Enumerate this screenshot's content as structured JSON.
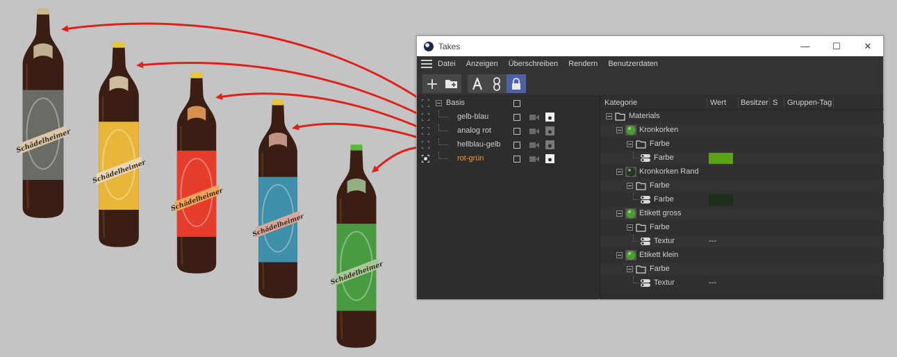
{
  "window": {
    "title": "Takes",
    "min_glyph": "—",
    "max_glyph": "☐",
    "close_glyph": "✕"
  },
  "menu": [
    "Datei",
    "Anzeigen",
    "Überschreiben",
    "Rendern",
    "Benutzerdaten"
  ],
  "takes": [
    {
      "label": "Basis",
      "level": 0,
      "active": false
    },
    {
      "label": "gelb-blau",
      "level": 1,
      "active": false
    },
    {
      "label": "analog rot",
      "level": 1,
      "active": false
    },
    {
      "label": "hellblau-gelb",
      "level": 1,
      "active": false
    },
    {
      "label": "rot-grün",
      "level": 1,
      "active": true
    }
  ],
  "columns": {
    "kategorie": "Kategorie",
    "wert": "Wert",
    "besitzer": "Besitzer",
    "s": "S",
    "gruppen_tag": "Gruppen-Tag"
  },
  "categories": [
    {
      "label": "Materials",
      "type": "folder",
      "level": 0
    },
    {
      "label": "Kronkorken",
      "type": "material",
      "level": 1,
      "ball_color": "#4aa02a"
    },
    {
      "label": "Farbe",
      "type": "folder",
      "level": 2
    },
    {
      "label": "Farbe",
      "type": "param",
      "level": 3,
      "swatch": "#5aa317"
    },
    {
      "label": "Kronkorken Rand",
      "type": "material",
      "level": 1,
      "ball_color": "#1f3a1a"
    },
    {
      "label": "Farbe",
      "type": "folder",
      "level": 2
    },
    {
      "label": "Farbe",
      "type": "param",
      "level": 3,
      "swatch": "#1e2e18"
    },
    {
      "label": "Etikett gross",
      "type": "material",
      "level": 1,
      "ball_color": "#4aa02a"
    },
    {
      "label": "Farbe",
      "type": "folder",
      "level": 2
    },
    {
      "label": "Textur",
      "type": "param",
      "level": 3,
      "value": "---"
    },
    {
      "label": "Etikett klein",
      "type": "material",
      "level": 1,
      "ball_color": "#4aa02a"
    },
    {
      "label": "Farbe",
      "type": "folder",
      "level": 2
    },
    {
      "label": "Textur",
      "type": "param",
      "level": 3,
      "value": "---"
    }
  ],
  "bottles": [
    {
      "brand": "Schädelheimer",
      "label_color": "#6b6b66",
      "cap_color": "#c9b98c",
      "ribbon_color": "#d9c9a8"
    },
    {
      "brand": "Schädelheimer",
      "label_color": "#e8b73a",
      "cap_color": "#e5c640",
      "ribbon_color": "#e9d7b6"
    },
    {
      "brand": "Schädelheimer",
      "label_color": "#e43d2c",
      "cap_color": "#e5c640",
      "ribbon_color": "#f2a45a"
    },
    {
      "brand": "Schädelheimer",
      "label_color": "#3f8fa8",
      "cap_color": "#e5c640",
      "ribbon_color": "#d9a89a"
    },
    {
      "brand": "Schädelheimer",
      "label_color": "#4a9a42",
      "cap_color": "#58b838",
      "ribbon_color": "#a7c89a"
    }
  ],
  "colors": {
    "arrow": "#e0201a",
    "accent_active": "#4f5fa8",
    "active_take": "#f39c28"
  }
}
